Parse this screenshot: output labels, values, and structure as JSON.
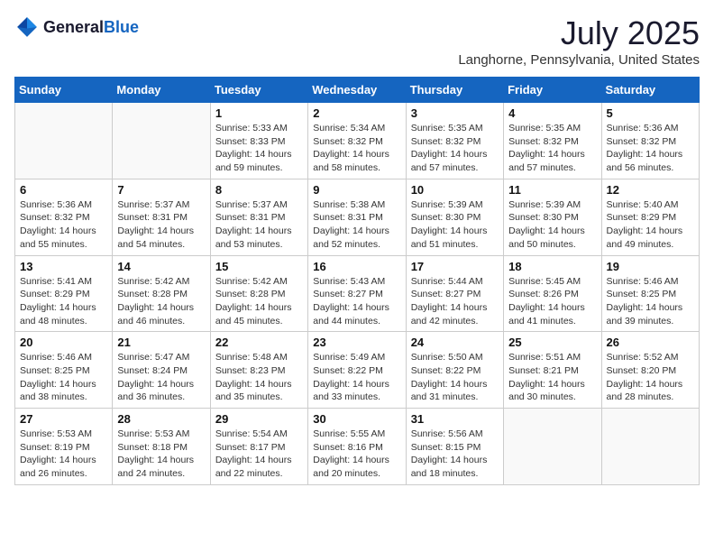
{
  "logo": {
    "general": "General",
    "blue": "Blue"
  },
  "header": {
    "title": "July 2025",
    "subtitle": "Langhorne, Pennsylvania, United States"
  },
  "weekdays": [
    "Sunday",
    "Monday",
    "Tuesday",
    "Wednesday",
    "Thursday",
    "Friday",
    "Saturday"
  ],
  "weeks": [
    [
      {
        "day": "",
        "sunrise": "",
        "sunset": "",
        "daylight": ""
      },
      {
        "day": "",
        "sunrise": "",
        "sunset": "",
        "daylight": ""
      },
      {
        "day": "1",
        "sunrise": "Sunrise: 5:33 AM",
        "sunset": "Sunset: 8:33 PM",
        "daylight": "Daylight: 14 hours and 59 minutes."
      },
      {
        "day": "2",
        "sunrise": "Sunrise: 5:34 AM",
        "sunset": "Sunset: 8:32 PM",
        "daylight": "Daylight: 14 hours and 58 minutes."
      },
      {
        "day": "3",
        "sunrise": "Sunrise: 5:35 AM",
        "sunset": "Sunset: 8:32 PM",
        "daylight": "Daylight: 14 hours and 57 minutes."
      },
      {
        "day": "4",
        "sunrise": "Sunrise: 5:35 AM",
        "sunset": "Sunset: 8:32 PM",
        "daylight": "Daylight: 14 hours and 57 minutes."
      },
      {
        "day": "5",
        "sunrise": "Sunrise: 5:36 AM",
        "sunset": "Sunset: 8:32 PM",
        "daylight": "Daylight: 14 hours and 56 minutes."
      }
    ],
    [
      {
        "day": "6",
        "sunrise": "Sunrise: 5:36 AM",
        "sunset": "Sunset: 8:32 PM",
        "daylight": "Daylight: 14 hours and 55 minutes."
      },
      {
        "day": "7",
        "sunrise": "Sunrise: 5:37 AM",
        "sunset": "Sunset: 8:31 PM",
        "daylight": "Daylight: 14 hours and 54 minutes."
      },
      {
        "day": "8",
        "sunrise": "Sunrise: 5:37 AM",
        "sunset": "Sunset: 8:31 PM",
        "daylight": "Daylight: 14 hours and 53 minutes."
      },
      {
        "day": "9",
        "sunrise": "Sunrise: 5:38 AM",
        "sunset": "Sunset: 8:31 PM",
        "daylight": "Daylight: 14 hours and 52 minutes."
      },
      {
        "day": "10",
        "sunrise": "Sunrise: 5:39 AM",
        "sunset": "Sunset: 8:30 PM",
        "daylight": "Daylight: 14 hours and 51 minutes."
      },
      {
        "day": "11",
        "sunrise": "Sunrise: 5:39 AM",
        "sunset": "Sunset: 8:30 PM",
        "daylight": "Daylight: 14 hours and 50 minutes."
      },
      {
        "day": "12",
        "sunrise": "Sunrise: 5:40 AM",
        "sunset": "Sunset: 8:29 PM",
        "daylight": "Daylight: 14 hours and 49 minutes."
      }
    ],
    [
      {
        "day": "13",
        "sunrise": "Sunrise: 5:41 AM",
        "sunset": "Sunset: 8:29 PM",
        "daylight": "Daylight: 14 hours and 48 minutes."
      },
      {
        "day": "14",
        "sunrise": "Sunrise: 5:42 AM",
        "sunset": "Sunset: 8:28 PM",
        "daylight": "Daylight: 14 hours and 46 minutes."
      },
      {
        "day": "15",
        "sunrise": "Sunrise: 5:42 AM",
        "sunset": "Sunset: 8:28 PM",
        "daylight": "Daylight: 14 hours and 45 minutes."
      },
      {
        "day": "16",
        "sunrise": "Sunrise: 5:43 AM",
        "sunset": "Sunset: 8:27 PM",
        "daylight": "Daylight: 14 hours and 44 minutes."
      },
      {
        "day": "17",
        "sunrise": "Sunrise: 5:44 AM",
        "sunset": "Sunset: 8:27 PM",
        "daylight": "Daylight: 14 hours and 42 minutes."
      },
      {
        "day": "18",
        "sunrise": "Sunrise: 5:45 AM",
        "sunset": "Sunset: 8:26 PM",
        "daylight": "Daylight: 14 hours and 41 minutes."
      },
      {
        "day": "19",
        "sunrise": "Sunrise: 5:46 AM",
        "sunset": "Sunset: 8:25 PM",
        "daylight": "Daylight: 14 hours and 39 minutes."
      }
    ],
    [
      {
        "day": "20",
        "sunrise": "Sunrise: 5:46 AM",
        "sunset": "Sunset: 8:25 PM",
        "daylight": "Daylight: 14 hours and 38 minutes."
      },
      {
        "day": "21",
        "sunrise": "Sunrise: 5:47 AM",
        "sunset": "Sunset: 8:24 PM",
        "daylight": "Daylight: 14 hours and 36 minutes."
      },
      {
        "day": "22",
        "sunrise": "Sunrise: 5:48 AM",
        "sunset": "Sunset: 8:23 PM",
        "daylight": "Daylight: 14 hours and 35 minutes."
      },
      {
        "day": "23",
        "sunrise": "Sunrise: 5:49 AM",
        "sunset": "Sunset: 8:22 PM",
        "daylight": "Daylight: 14 hours and 33 minutes."
      },
      {
        "day": "24",
        "sunrise": "Sunrise: 5:50 AM",
        "sunset": "Sunset: 8:22 PM",
        "daylight": "Daylight: 14 hours and 31 minutes."
      },
      {
        "day": "25",
        "sunrise": "Sunrise: 5:51 AM",
        "sunset": "Sunset: 8:21 PM",
        "daylight": "Daylight: 14 hours and 30 minutes."
      },
      {
        "day": "26",
        "sunrise": "Sunrise: 5:52 AM",
        "sunset": "Sunset: 8:20 PM",
        "daylight": "Daylight: 14 hours and 28 minutes."
      }
    ],
    [
      {
        "day": "27",
        "sunrise": "Sunrise: 5:53 AM",
        "sunset": "Sunset: 8:19 PM",
        "daylight": "Daylight: 14 hours and 26 minutes."
      },
      {
        "day": "28",
        "sunrise": "Sunrise: 5:53 AM",
        "sunset": "Sunset: 8:18 PM",
        "daylight": "Daylight: 14 hours and 24 minutes."
      },
      {
        "day": "29",
        "sunrise": "Sunrise: 5:54 AM",
        "sunset": "Sunset: 8:17 PM",
        "daylight": "Daylight: 14 hours and 22 minutes."
      },
      {
        "day": "30",
        "sunrise": "Sunrise: 5:55 AM",
        "sunset": "Sunset: 8:16 PM",
        "daylight": "Daylight: 14 hours and 20 minutes."
      },
      {
        "day": "31",
        "sunrise": "Sunrise: 5:56 AM",
        "sunset": "Sunset: 8:15 PM",
        "daylight": "Daylight: 14 hours and 18 minutes."
      },
      {
        "day": "",
        "sunrise": "",
        "sunset": "",
        "daylight": ""
      },
      {
        "day": "",
        "sunrise": "",
        "sunset": "",
        "daylight": ""
      }
    ]
  ]
}
